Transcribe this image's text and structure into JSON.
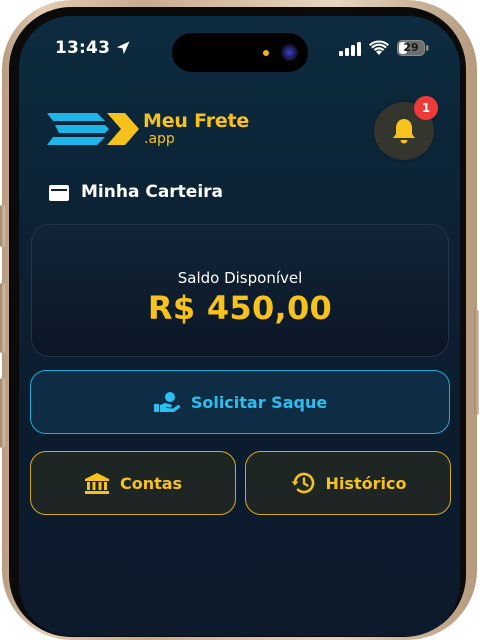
{
  "status_bar": {
    "time": "13:43",
    "battery": "29"
  },
  "header": {
    "logo_title": "Meu Frete",
    "logo_subtitle": ".app",
    "notification_count": "1"
  },
  "wallet": {
    "title": "Minha Carteira",
    "balance_label": "Saldo Disponível",
    "balance_value": "R$ 450,00"
  },
  "actions": {
    "withdraw_label": "Solicitar Saque",
    "accounts_label": "Contas",
    "history_label": "Histórico"
  },
  "icons": {
    "location": "location-arrow-icon",
    "signal": "cellular-signal-icon",
    "wifi": "wifi-icon",
    "battery": "battery-icon",
    "bell": "bell-icon",
    "wallet": "wallet-icon",
    "withdraw": "hand-money-icon",
    "accounts": "bank-icon",
    "history": "history-clock-icon"
  },
  "colors": {
    "accent_yellow": "#f6c21b",
    "accent_blue": "#2bc0f0",
    "badge_red": "#ef3a3a",
    "background_dark": "#0c2234"
  }
}
